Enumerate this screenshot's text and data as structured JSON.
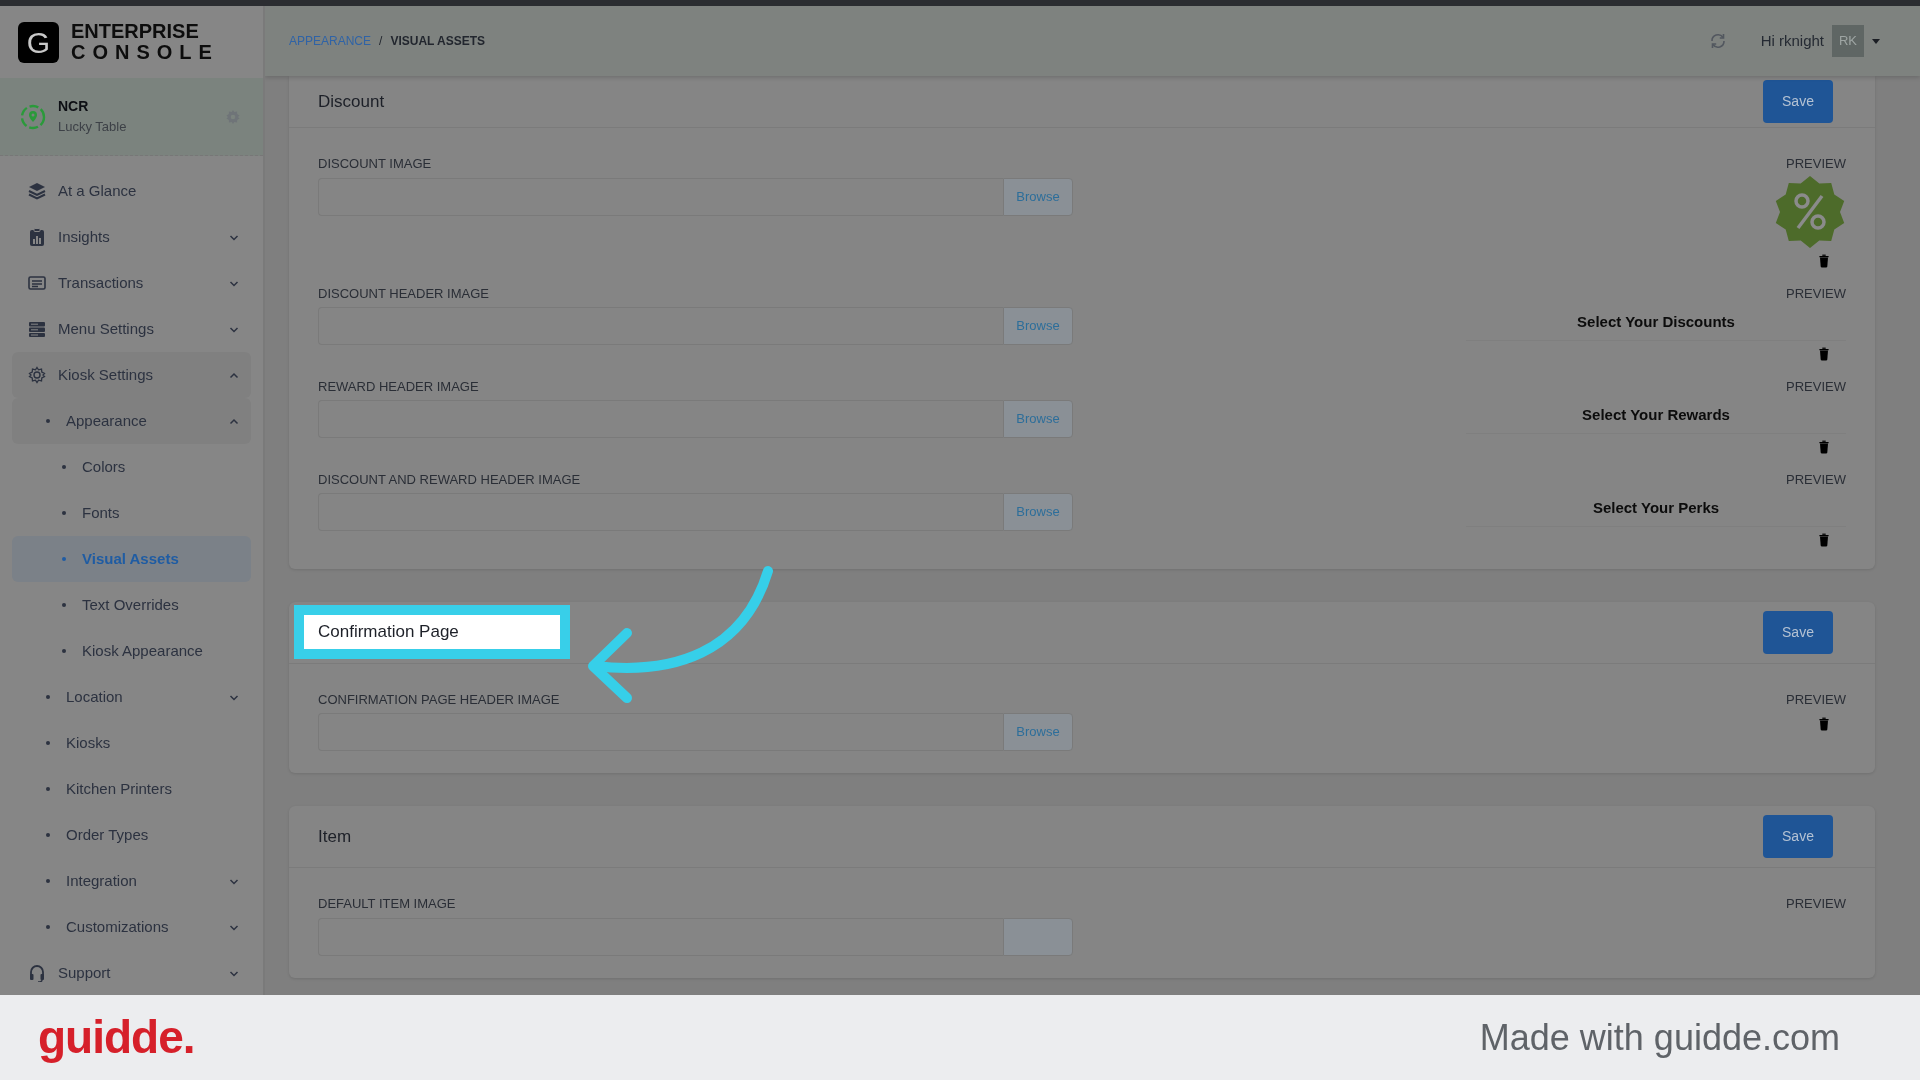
{
  "brand": {
    "logo_letter": "G",
    "line_1": "ENTERPRISE",
    "line_2": "CONSOLE"
  },
  "store": {
    "name": "NCR",
    "subtitle": "Lucky Table"
  },
  "nav": [
    {
      "label": "At a Glance",
      "selected": false
    },
    {
      "label": "Insights",
      "selected": false,
      "expanded": false
    },
    {
      "label": "Transactions",
      "selected": false,
      "expanded": false
    },
    {
      "label": "Menu Settings",
      "selected": false,
      "expanded": false
    },
    {
      "label": "Kiosk Settings",
      "selected": false,
      "expanded": true,
      "children": [
        {
          "label": "Appearance",
          "selected": false,
          "expanded": true,
          "children": [
            {
              "label": "Colors",
              "selected": false
            },
            {
              "label": "Fonts",
              "selected": false
            },
            {
              "label": "Visual Assets",
              "selected": true
            },
            {
              "label": "Text Overrides",
              "selected": false
            },
            {
              "label": "Kiosk Appearance",
              "selected": false
            }
          ]
        },
        {
          "label": "Location",
          "selected": false,
          "expanded": false
        },
        {
          "label": "Kiosks",
          "selected": false
        },
        {
          "label": "Kitchen Printers",
          "selected": false
        },
        {
          "label": "Order Types",
          "selected": false
        },
        {
          "label": "Integration",
          "selected": false,
          "expanded": false
        },
        {
          "label": "Customizations",
          "selected": false,
          "expanded": false
        }
      ]
    },
    {
      "label": "Support",
      "selected": false,
      "expanded": false
    }
  ],
  "breadcrumb": {
    "items": [
      {
        "label": "APPEARANCE",
        "link": true
      },
      {
        "label": "VISUAL ASSETS",
        "link": false
      }
    ],
    "separator": "/"
  },
  "user": {
    "greeting": "Hi rknight",
    "initials": "RK"
  },
  "sections": [
    {
      "title": "Discount",
      "highlighted": false,
      "save_label": "Save",
      "fields": [
        {
          "label": "DISCOUNT IMAGE",
          "browse_label": "Browse",
          "preview_label": "PREVIEW",
          "preview": {
            "kind": "badge"
          }
        },
        {
          "label": "DISCOUNT HEADER IMAGE",
          "browse_label": "Browse",
          "preview_label": "PREVIEW",
          "preview": {
            "kind": "text",
            "text": "Select Your Discounts"
          }
        },
        {
          "label": "REWARD HEADER IMAGE",
          "browse_label": "Browse",
          "preview_label": "PREVIEW",
          "preview": {
            "kind": "text",
            "text": "Select Your Rewards"
          }
        },
        {
          "label": "DISCOUNT AND REWARD HEADER IMAGE",
          "browse_label": "Browse",
          "preview_label": "PREVIEW",
          "preview": {
            "kind": "text",
            "text": "Select Your Perks"
          }
        }
      ]
    },
    {
      "title": "Confirmation Page",
      "highlighted": true,
      "save_label": "Save",
      "fields": [
        {
          "label": "CONFIRMATION PAGE HEADER IMAGE",
          "browse_label": "Browse",
          "preview_label": "PREVIEW",
          "preview": {
            "kind": "empty"
          }
        }
      ]
    },
    {
      "title": "Item",
      "highlighted": false,
      "save_label": "Save",
      "fields": [
        {
          "label": "DEFAULT ITEM IMAGE",
          "preview_label": "PREVIEW",
          "preview": {
            "kind": "cut"
          }
        }
      ]
    }
  ],
  "footer_banner": {
    "logo": "guidde.",
    "credit": "Made with guidde.com"
  }
}
